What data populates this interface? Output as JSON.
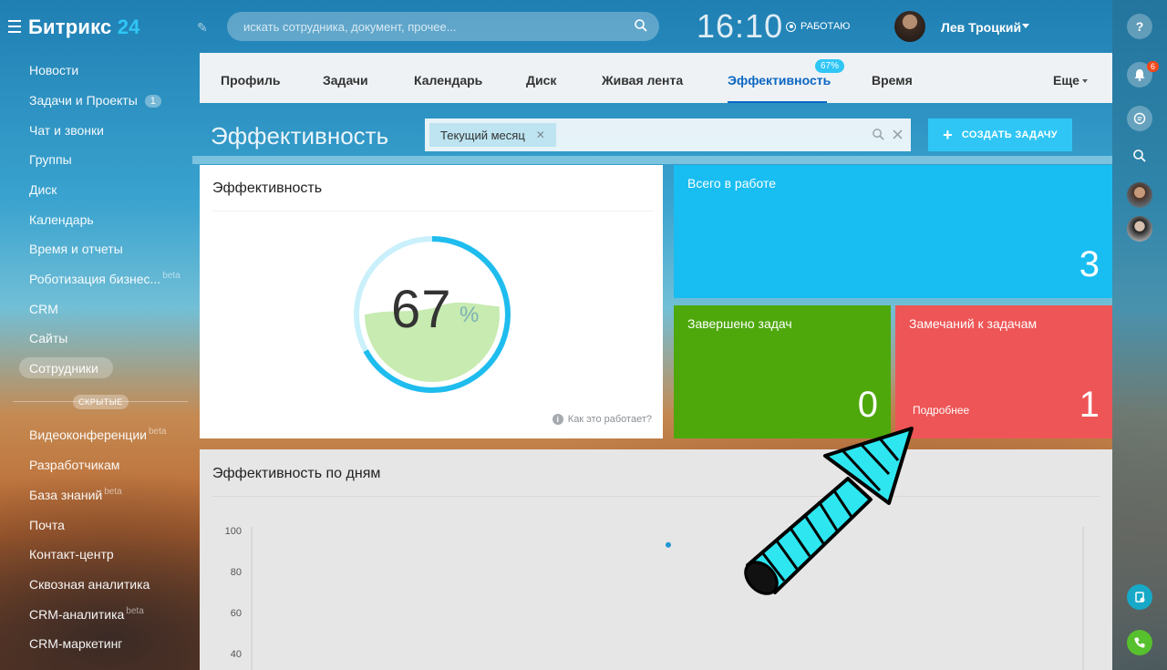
{
  "header": {
    "logo_text": "Битрикс",
    "logo_number": "24",
    "search_placeholder": "искать сотрудника, документ, прочее...",
    "clock": "16:10",
    "status": "РАБОТАЮ",
    "user_name": "Лев Троцкий"
  },
  "sidebar": {
    "items": [
      {
        "label": "Новости"
      },
      {
        "label": "Задачи и Проекты",
        "counter": "1"
      },
      {
        "label": "Чат и звонки"
      },
      {
        "label": "Группы"
      },
      {
        "label": "Диск"
      },
      {
        "label": "Календарь"
      },
      {
        "label": "Время и отчеты"
      },
      {
        "label": "Роботизация бизнес...",
        "beta": "beta"
      },
      {
        "label": "CRM"
      },
      {
        "label": "Сайты"
      },
      {
        "label": "Сотрудники"
      }
    ],
    "hidden_label": "СКРЫТЫЕ",
    "hidden_items": [
      {
        "label": "Видеоконференции",
        "beta": "beta"
      },
      {
        "label": "Разработчикам"
      },
      {
        "label": "База знаний",
        "beta": "beta"
      },
      {
        "label": "Почта"
      },
      {
        "label": "Контакт-центр"
      },
      {
        "label": "Сквозная аналитика"
      },
      {
        "label": "CRM-аналитика",
        "beta": "beta"
      },
      {
        "label": "CRM-маркетинг"
      }
    ]
  },
  "tabs": {
    "items": [
      {
        "label": "Профиль"
      },
      {
        "label": "Задачи"
      },
      {
        "label": "Календарь"
      },
      {
        "label": "Диск"
      },
      {
        "label": "Живая лента"
      },
      {
        "label": "Эффективность",
        "badge": "67%",
        "active": true
      },
      {
        "label": "Время"
      }
    ],
    "more": "Еще"
  },
  "page": {
    "title": "Эффективность",
    "filter_chip": "Текущий месяц",
    "create_button": "СОЗДАТЬ ЗАДАЧУ"
  },
  "efficiency": {
    "title": "Эффективность",
    "value": "67",
    "unit": "%",
    "fraction": 0.67,
    "how_it_works": "Как это работает?"
  },
  "tiles": {
    "in_work": {
      "title": "Всего в работе",
      "value": "3",
      "color": "#18bdf2"
    },
    "completed": {
      "title": "Завершено задач",
      "value": "0",
      "color": "#4ea80c"
    },
    "remarks": {
      "title": "Замечаний к задачам",
      "value": "1",
      "more": "Подробнее",
      "color": "#ee5556"
    }
  },
  "daily_chart": {
    "title": "Эффективность по дням",
    "chart_data": {
      "type": "line",
      "y_ticks": [
        "100",
        "80",
        "60",
        "40"
      ],
      "ylim": [
        40,
        100
      ],
      "points": [
        {
          "y": 97
        }
      ]
    }
  },
  "right_panel": {
    "notification_count": "6"
  },
  "colors": {
    "accent": "#2fc6f6",
    "active_tab": "#0b66c3",
    "annotation_arrow": "#2ee6f0"
  }
}
